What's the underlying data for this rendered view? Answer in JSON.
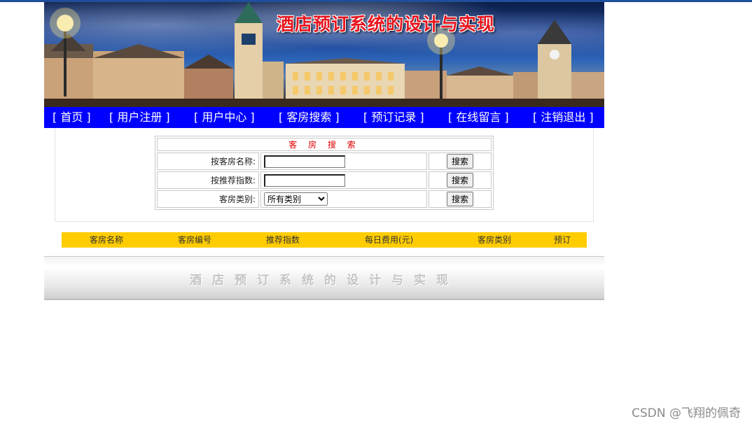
{
  "banner": {
    "title": "酒店预订系统的设计与实现"
  },
  "nav": {
    "items": [
      "[ 首页 ]",
      "[ 用户注册 ]",
      "[ 用户中心 ]",
      "[ 客房搜索 ]",
      "[ 预订记录 ]",
      "[ 在线留言 ]",
      "[ 注销退出 ]"
    ]
  },
  "search": {
    "title": "客 房 搜 索",
    "by_name_label": "按客房名称:",
    "by_name_value": "",
    "by_rating_label": "按推荐指数:",
    "by_rating_value": "",
    "category_label": "客房类别:",
    "category_selected": "所有类别",
    "button_label": "搜索"
  },
  "results": {
    "columns": [
      "客房名称",
      "客房编号",
      "推荐指数",
      "每日费用(元)",
      "客房类别",
      "预订"
    ]
  },
  "footer": {
    "text": "酒店预订系统的设计与实现"
  },
  "watermark": "CSDN @飞翔的佩奇",
  "colors": {
    "nav_bg": "#0000ff",
    "result_header_bg": "#ffcc00",
    "title_red": "#e8141e",
    "top_line": "#1f4f9a"
  }
}
